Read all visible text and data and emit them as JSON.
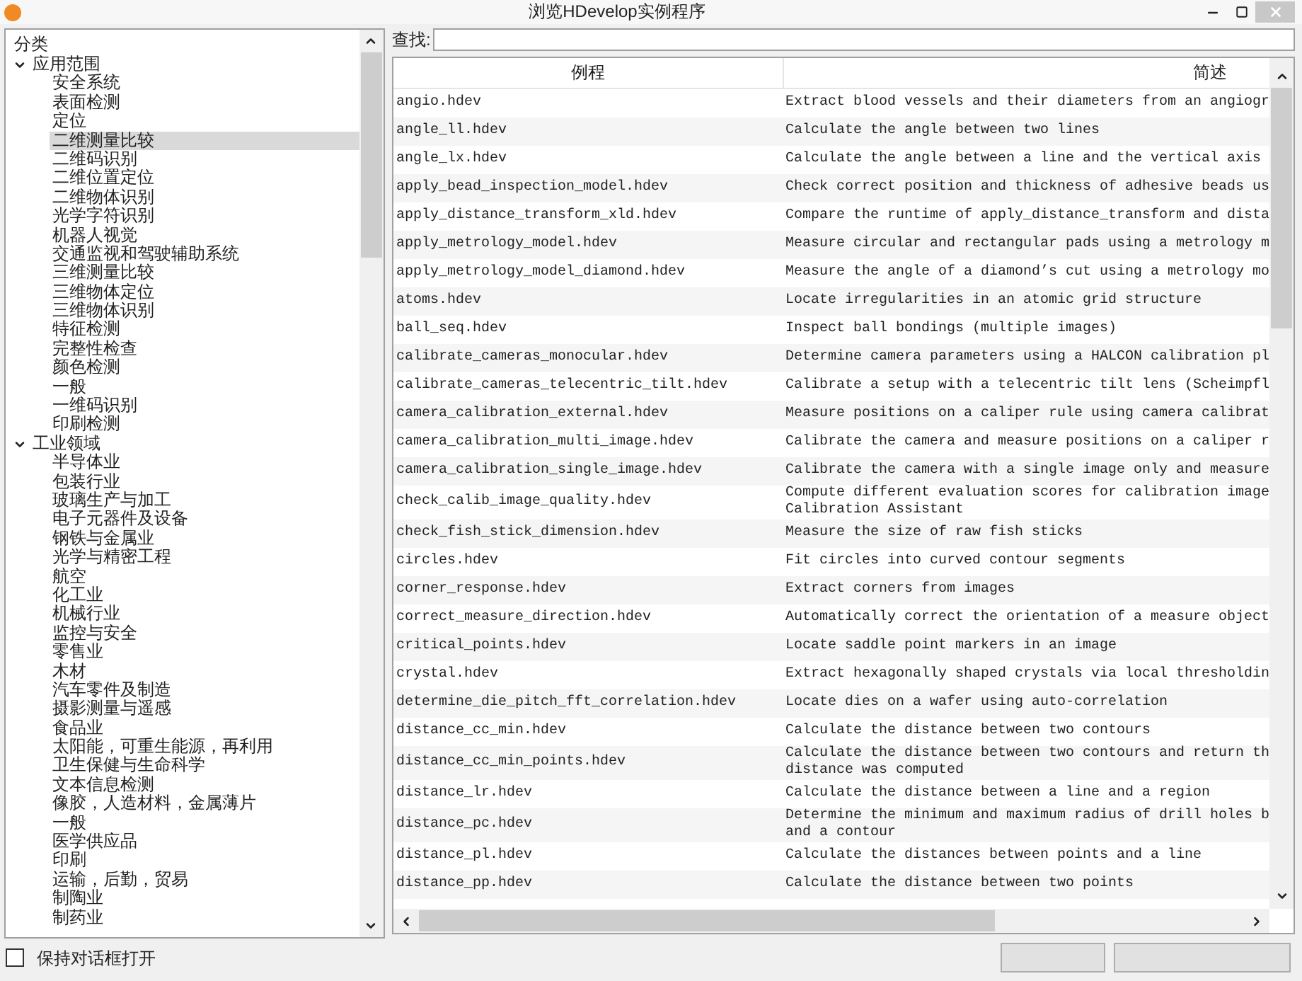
{
  "window": {
    "title": "浏览HDevelop实例程序"
  },
  "tree": {
    "heading": "分类",
    "groups": [
      {
        "label": "应用范围",
        "expanded": true,
        "children": [
          {
            "label": "安全系统",
            "selected": false
          },
          {
            "label": "表面检测",
            "selected": false
          },
          {
            "label": "定位",
            "selected": false
          },
          {
            "label": "二维测量比较",
            "selected": true
          },
          {
            "label": "二维码识别",
            "selected": false
          },
          {
            "label": "二维位置定位",
            "selected": false
          },
          {
            "label": "二维物体识别",
            "selected": false
          },
          {
            "label": "光学字符识别",
            "selected": false
          },
          {
            "label": "机器人视觉",
            "selected": false
          },
          {
            "label": "交通监视和驾驶辅助系统",
            "selected": false
          },
          {
            "label": "三维测量比较",
            "selected": false
          },
          {
            "label": "三维物体定位",
            "selected": false
          },
          {
            "label": "三维物体识别",
            "selected": false
          },
          {
            "label": "特征检测",
            "selected": false
          },
          {
            "label": "完整性检查",
            "selected": false
          },
          {
            "label": "颜色检测",
            "selected": false
          },
          {
            "label": "一般",
            "selected": false
          },
          {
            "label": "一维码识别",
            "selected": false
          },
          {
            "label": "印刷检测",
            "selected": false
          }
        ]
      },
      {
        "label": "工业领域",
        "expanded": true,
        "children": [
          {
            "label": "半导体业",
            "selected": false
          },
          {
            "label": "包装行业",
            "selected": false
          },
          {
            "label": "玻璃生产与加工",
            "selected": false
          },
          {
            "label": "电子元器件及设备",
            "selected": false
          },
          {
            "label": "钢铁与金属业",
            "selected": false
          },
          {
            "label": "光学与精密工程",
            "selected": false
          },
          {
            "label": "航空",
            "selected": false
          },
          {
            "label": "化工业",
            "selected": false
          },
          {
            "label": "机械行业",
            "selected": false
          },
          {
            "label": "监控与安全",
            "selected": false
          },
          {
            "label": "零售业",
            "selected": false
          },
          {
            "label": "木材",
            "selected": false
          },
          {
            "label": "汽车零件及制造",
            "selected": false
          },
          {
            "label": "摄影测量与遥感",
            "selected": false
          },
          {
            "label": "食品业",
            "selected": false
          },
          {
            "label": "太阳能，可重生能源，再利用",
            "selected": false
          },
          {
            "label": "卫生保健与生命科学",
            "selected": false
          },
          {
            "label": "文本信息检测",
            "selected": false
          },
          {
            "label": "像胶，人造材料，金属薄片",
            "selected": false
          },
          {
            "label": "一般",
            "selected": false
          },
          {
            "label": "医学供应品",
            "selected": false
          },
          {
            "label": "印刷",
            "selected": false
          },
          {
            "label": "运输，后勤，贸易",
            "selected": false
          },
          {
            "label": "制陶业",
            "selected": false
          },
          {
            "label": "制药业",
            "selected": false
          }
        ]
      }
    ]
  },
  "search": {
    "label": "查找:"
  },
  "table": {
    "columns": [
      "例程",
      "简述"
    ],
    "rows": [
      {
        "name": "angio.hdev",
        "description": "Extract blood vessels and their diameters from an angiogr"
      },
      {
        "name": "angle_ll.hdev",
        "description": "Calculate the angle between two lines"
      },
      {
        "name": "angle_lx.hdev",
        "description": "Calculate the angle between a line and the vertical axis"
      },
      {
        "name": "apply_bead_inspection_model.hdev",
        "description": "Check correct position and thickness of adhesive beads us"
      },
      {
        "name": "apply_distance_transform_xld.hdev",
        "description": "Compare the runtime of apply_distance_transform and dista"
      },
      {
        "name": "apply_metrology_model.hdev",
        "description": "Measure circular and rectangular pads using a metrology m"
      },
      {
        "name": "apply_metrology_model_diamond.hdev",
        "description": "Measure the angle of a diamond’s cut using a metrology mo"
      },
      {
        "name": "atoms.hdev",
        "description": "Locate irregularities in an atomic grid structure"
      },
      {
        "name": "ball_seq.hdev",
        "description": "Inspect ball bondings (multiple images)"
      },
      {
        "name": "calibrate_cameras_monocular.hdev",
        "description": "Determine camera parameters using a HALCON calibration pl"
      },
      {
        "name": "calibrate_cameras_telecentric_tilt.hdev",
        "description": "Calibrate a setup with a telecentric tilt lens (Scheimpfl"
      },
      {
        "name": "camera_calibration_external.hdev",
        "description": "Measure positions on a caliper rule using camera calibrat"
      },
      {
        "name": "camera_calibration_multi_image.hdev",
        "description": "Calibrate the camera and measure positions on a caliper r"
      },
      {
        "name": "camera_calibration_single_image.hdev",
        "description": "Calibrate the camera with a single image only and measure"
      },
      {
        "name": "check_calib_image_quality.hdev",
        "description": "Compute different evaluation scores for calibration image\nCalibration Assistant"
      },
      {
        "name": "check_fish_stick_dimension.hdev",
        "description": "Measure the size of raw fish sticks"
      },
      {
        "name": "circles.hdev",
        "description": "Fit circles into curved contour segments"
      },
      {
        "name": "corner_response.hdev",
        "description": "Extract corners from images"
      },
      {
        "name": "correct_measure_direction.hdev",
        "description": "Automatically correct the orientation of a measure object"
      },
      {
        "name": "critical_points.hdev",
        "description": "Locate saddle point markers in an image"
      },
      {
        "name": "crystal.hdev",
        "description": "Extract hexagonally shaped crystals via local thresholdin"
      },
      {
        "name": "determine_die_pitch_fft_correlation.hdev",
        "description": "Locate dies on a wafer using auto-correlation"
      },
      {
        "name": "distance_cc_min.hdev",
        "description": "Calculate the distance between two contours"
      },
      {
        "name": "distance_cc_min_points.hdev",
        "description": "Calculate the distance between two contours and return th\ndistance was computed"
      },
      {
        "name": "distance_lr.hdev",
        "description": "Calculate the distance between a line and a region"
      },
      {
        "name": "distance_pc.hdev",
        "description": "Determine the minimum and maximum radius of drill holes b\nand a contour"
      },
      {
        "name": "distance_pl.hdev",
        "description": "Calculate the distances between points and a line"
      },
      {
        "name": "distance_pp.hdev",
        "description": "Calculate the distance between two points"
      }
    ]
  },
  "keep_open": {
    "label": "保持对话框打开",
    "checked": false
  }
}
